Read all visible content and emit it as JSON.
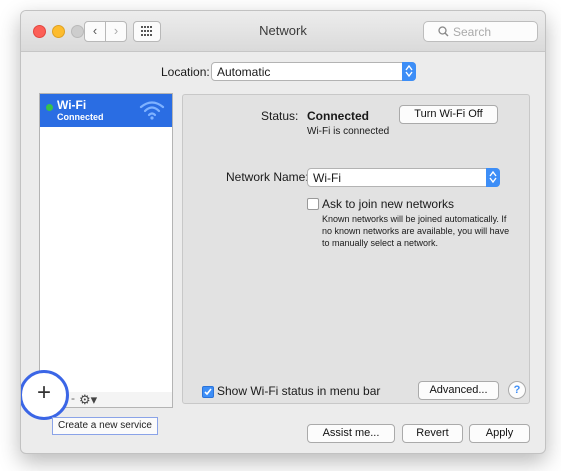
{
  "window": {
    "title": "Network"
  },
  "toolbar": {
    "back_glyph": "‹",
    "forward_glyph": "›",
    "search_placeholder": "Search"
  },
  "location": {
    "label": "Location:",
    "value": "Automatic"
  },
  "sidebar": {
    "services": [
      {
        "name": "Wi-Fi",
        "status": "Connected",
        "status_color": "#37c24a"
      }
    ],
    "add_glyph": "+",
    "remove_glyph": "-",
    "gear_glyph": "⚙▾",
    "tooltip": "Create a new service"
  },
  "panel": {
    "status_label": "Status:",
    "status_value": "Connected",
    "status_detail": "Wi-Fi is connected",
    "turn_off_label": "Turn Wi-Fi Off",
    "network_name_label": "Network Name:",
    "network_name_value": "Wi-Fi",
    "ask_join_label": "Ask to join new networks",
    "ask_join_checked": false,
    "ask_join_help": "Known networks will be joined automatically. If no known networks are available, you will have to manually select a network.",
    "show_status_label": "Show Wi-Fi status in menu bar",
    "show_status_checked": true,
    "advanced_label": "Advanced...",
    "help_glyph": "?"
  },
  "footer": {
    "assist_label": "Assist me...",
    "revert_label": "Revert",
    "apply_label": "Apply"
  },
  "colors": {
    "accent": "#3d8ef7",
    "selection": "#2a6de3",
    "highlight_ring": "#3b66e6"
  }
}
